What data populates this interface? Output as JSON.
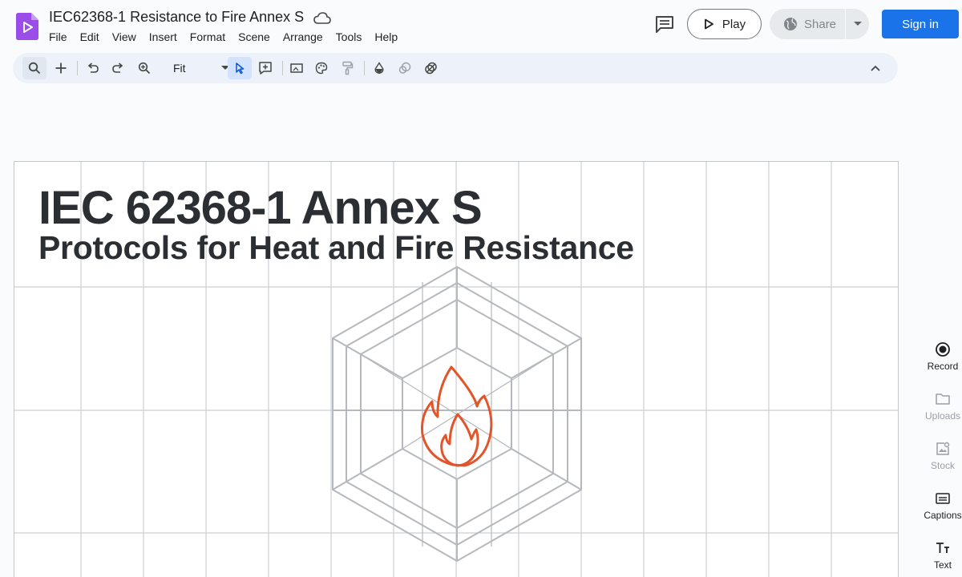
{
  "app": {
    "logo": "video-app-logo"
  },
  "document": {
    "title": "IEC62368-1 Resistance to Fire Annex S"
  },
  "menu": [
    "File",
    "Edit",
    "View",
    "Insert",
    "Format",
    "Scene",
    "Arrange",
    "Tools",
    "Help"
  ],
  "header": {
    "play_label": "Play",
    "share_label": "Share",
    "signin_label": "Sign in"
  },
  "toolbar": {
    "zoom_value": "Fit",
    "icons": [
      "search-icon",
      "add-icon",
      "undo-icon",
      "redo-icon",
      "zoom-icon",
      "select-icon",
      "new-text-box-icon",
      "image-icon",
      "palette-icon",
      "paint-format-icon",
      "fill-color-icon",
      "border-color-icon",
      "border-weight-icon",
      "collapse-icon"
    ]
  },
  "slide": {
    "heading": "IEC 62368-1 Annex S",
    "subheading": "Protocols for Heat and Fire Resistance"
  },
  "side_panel": {
    "record": "Record",
    "uploads": "Uploads",
    "stock": "Stock",
    "captions": "Captions",
    "text": "Text"
  },
  "colors": {
    "accent": "#1a73e8",
    "flame": "#e2542a",
    "toolbar_bg": "#edf2fa",
    "active_tool": "#d3e3fd"
  }
}
